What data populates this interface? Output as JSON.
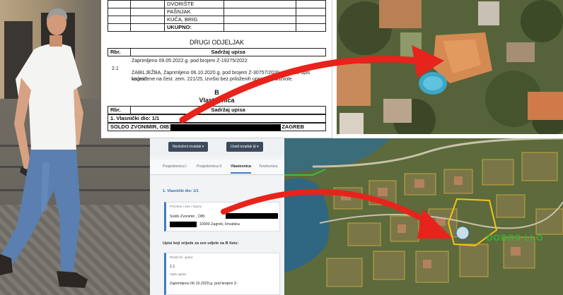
{
  "document": {
    "top_rows": [
      "PAŠNJAK",
      "KUĆA, BRIG"
    ],
    "top_faded": "DVORIŠTE",
    "ukupno": "UKUPNO:",
    "section_title": "DRUGI ODJELJAK",
    "col_rbr": "Rbr.",
    "col_sadrzaj": "Sadržaj upisa",
    "entry_number": "2.1",
    "entry_line1": "Zaprimljeno 09.05.2022.g. pod brojem Z-19275/2022",
    "entry_line2": "ZABILJEŽBA, Zaprimljeno 06.10.2020.g. pod brojem Z-30757/2020 se da se upis kuće i",
    "entry_line3": "sagrađene na čest. zem. 221/25, izvršio bez priloženih uporabne dozvole.",
    "b_letter": "B",
    "b_title": "Vlastovnica",
    "owner_share": "1. Vlasnički dio: 1/1",
    "owner_name": "SOLDO ZVONIMIR, OIB:",
    "owner_city": "10000 ZAGREB"
  },
  "web_ui": {
    "btn_left": "Nesluženi izvadak ▾",
    "btn_right": "Uradi izvadak ⊞ ▾",
    "tabs": [
      "Posjedovnica I",
      "Posjedovnica II",
      "Vlastovnica",
      "Teretovnica"
    ],
    "section_title": "1. Vlasnički dio: 1/1",
    "owner_label": "Prezime i ime / Naziv",
    "owner_value": "Soldo Zvonimir , OIB:",
    "owner_address": ", 10000 Zagreb, Hrvatska",
    "sub_title": "Upisi koji vrijede za sve udjele na B listu:",
    "redni_label": "Redni br. upisa:",
    "redni_value": "1.1",
    "opis_label": "Opis upisa:",
    "opis_value": "Zaprimljeno 06.10.2020.g. pod brojem Z-"
  },
  "map": {
    "label": "DOBOS LLO"
  },
  "colors": {
    "arrow": "#e8231b",
    "link": "#2d6fb5",
    "map_text": "#35b03b",
    "plot_outline": "#f2c417"
  }
}
